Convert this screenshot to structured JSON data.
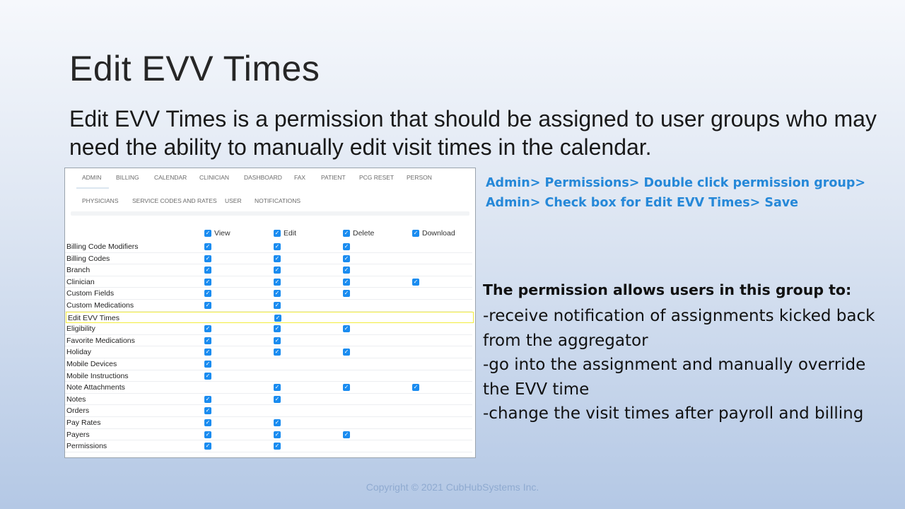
{
  "slide": {
    "title": "Edit EVV Times",
    "subtitle": "Edit EVV Times is a permission that should be assigned to user groups who may need the ability to manually edit visit times in the calendar.",
    "instructions": "Admin> Permissions> Double click permission group> Admin> Check box for Edit EVV Times> Save",
    "permission_heading": "The permission allows users in this group to:",
    "permission_items": [
      "-receive notification of assignments kicked back from the aggregator",
      "-go into the assignment and manually override the EVV time",
      "-change the visit times after payroll and billing"
    ],
    "copyright": "Copyright © 2021 CubHubSystems Inc."
  },
  "screenshot": {
    "tabs_row1": [
      "Admin",
      "Billing",
      "Calendar",
      "Clinician",
      "Dashboard",
      "Fax",
      "Patient",
      "PCG Reset",
      "Person"
    ],
    "tabs_row2": [
      "Physicians",
      "Service Codes and Rates",
      "User",
      "Notifications"
    ],
    "active_tab": "Admin",
    "columns": [
      "View",
      "Edit",
      "Delete",
      "Download"
    ],
    "checkbox_icon": "check-icon",
    "accent_color": "#1a8cf0",
    "highlight_color": "#f2ec3c",
    "highlighted_row": "Edit EVV Times",
    "rows": [
      {
        "label": "Billing Code Modifiers",
        "view": true,
        "edit": true,
        "delete": true,
        "download": false
      },
      {
        "label": "Billing Codes",
        "view": true,
        "edit": true,
        "delete": true,
        "download": false
      },
      {
        "label": "Branch",
        "view": true,
        "edit": true,
        "delete": true,
        "download": false
      },
      {
        "label": "Clinician",
        "view": true,
        "edit": true,
        "delete": true,
        "download": true
      },
      {
        "label": "Custom Fields",
        "view": true,
        "edit": true,
        "delete": true,
        "download": false
      },
      {
        "label": "Custom Medications",
        "view": true,
        "edit": true,
        "delete": false,
        "download": false
      },
      {
        "label": "Edit EVV Times",
        "view": false,
        "edit": true,
        "delete": false,
        "download": false
      },
      {
        "label": "Eligibility",
        "view": true,
        "edit": true,
        "delete": true,
        "download": false
      },
      {
        "label": "Favorite Medications",
        "view": true,
        "edit": true,
        "delete": false,
        "download": false
      },
      {
        "label": "Holiday",
        "view": true,
        "edit": true,
        "delete": true,
        "download": false
      },
      {
        "label": "Mobile Devices",
        "view": true,
        "edit": false,
        "delete": false,
        "download": false
      },
      {
        "label": "Mobile Instructions",
        "view": true,
        "edit": false,
        "delete": false,
        "download": false
      },
      {
        "label": "Note Attachments",
        "view": false,
        "edit": true,
        "delete": true,
        "download": true
      },
      {
        "label": "Notes",
        "view": true,
        "edit": true,
        "delete": false,
        "download": false
      },
      {
        "label": "Orders",
        "view": true,
        "edit": false,
        "delete": false,
        "download": false
      },
      {
        "label": "Pay Rates",
        "view": true,
        "edit": true,
        "delete": false,
        "download": false
      },
      {
        "label": "Payers",
        "view": true,
        "edit": true,
        "delete": true,
        "download": false
      },
      {
        "label": "Permissions",
        "view": true,
        "edit": true,
        "delete": false,
        "download": false
      }
    ]
  }
}
